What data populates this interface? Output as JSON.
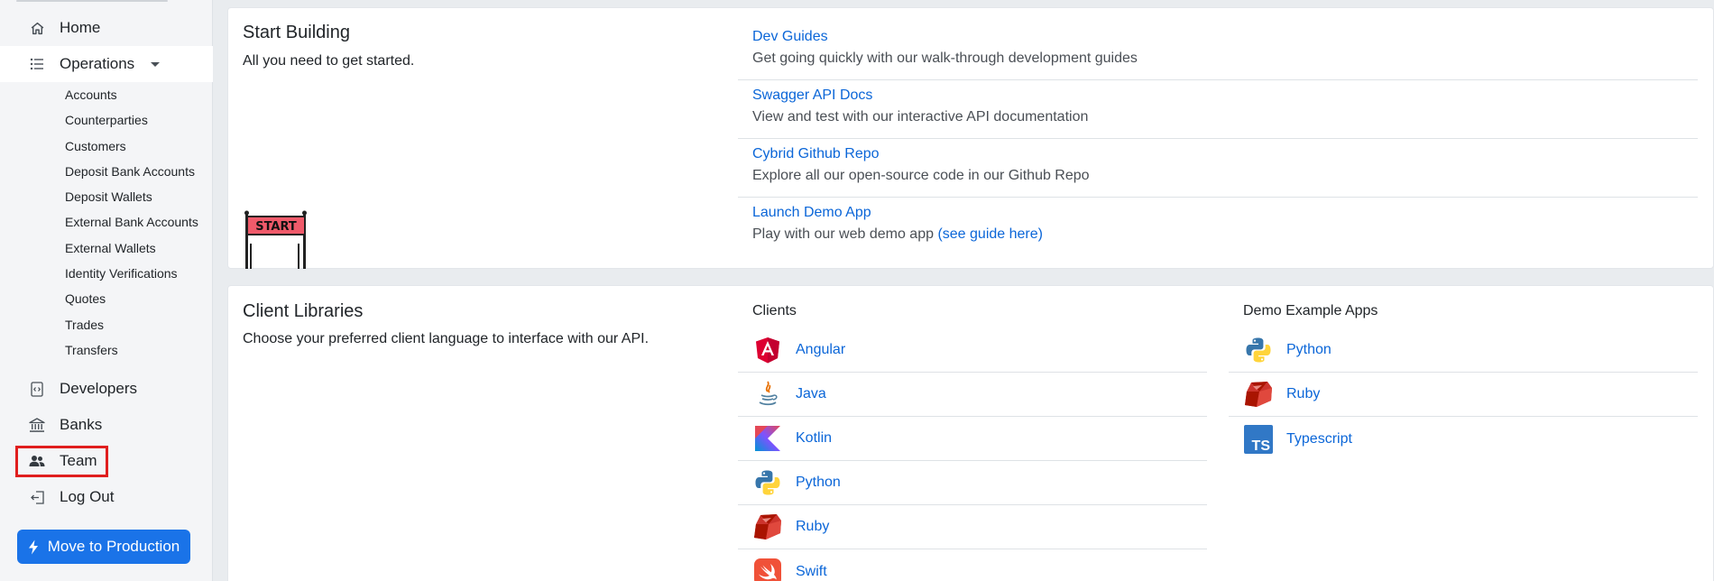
{
  "sidebar": {
    "home": "Home",
    "operations": "Operations",
    "sub_items": [
      "Accounts",
      "Counterparties",
      "Customers",
      "Deposit Bank Accounts",
      "Deposit Wallets",
      "External Bank Accounts",
      "External Wallets",
      "Identity Verifications",
      "Quotes",
      "Trades",
      "Transfers"
    ],
    "developers": "Developers",
    "banks": "Banks",
    "team": "Team",
    "logout": "Log Out",
    "production_button": "Move to Production"
  },
  "start_building": {
    "title": "Start Building",
    "subtitle": "All you need to get started.",
    "banner_text": "START",
    "links": [
      {
        "label": "Dev Guides",
        "desc": "Get going quickly with our walk-through development guides"
      },
      {
        "label": "Swagger API Docs",
        "desc": "View and test with our interactive API documentation"
      },
      {
        "label": "Cybrid Github Repo",
        "desc": "Explore all our open-source code in our Github Repo"
      },
      {
        "label": "Launch Demo App",
        "desc": "Play with our web demo app",
        "desc_link": "(see guide here)"
      }
    ]
  },
  "client_libraries": {
    "title": "Client Libraries",
    "subtitle": "Choose your preferred client language to interface with our API.",
    "clients_heading": "Clients",
    "clients": [
      {
        "name": "Angular",
        "icon": "angular-icon"
      },
      {
        "name": "Java",
        "icon": "java-icon"
      },
      {
        "name": "Kotlin",
        "icon": "kotlin-icon"
      },
      {
        "name": "Python",
        "icon": "python-icon"
      },
      {
        "name": "Ruby",
        "icon": "ruby-icon"
      },
      {
        "name": "Swift",
        "icon": "swift-icon"
      }
    ],
    "demo_heading": "Demo Example Apps",
    "demos": [
      {
        "name": "Python",
        "icon": "python-icon"
      },
      {
        "name": "Ruby",
        "icon": "ruby-icon"
      },
      {
        "name": "Typescript",
        "icon": "typescript-icon"
      }
    ]
  },
  "colors": {
    "accent": "#1a73e8",
    "link": "#0b66d8",
    "highlight": "#e01e1e"
  }
}
